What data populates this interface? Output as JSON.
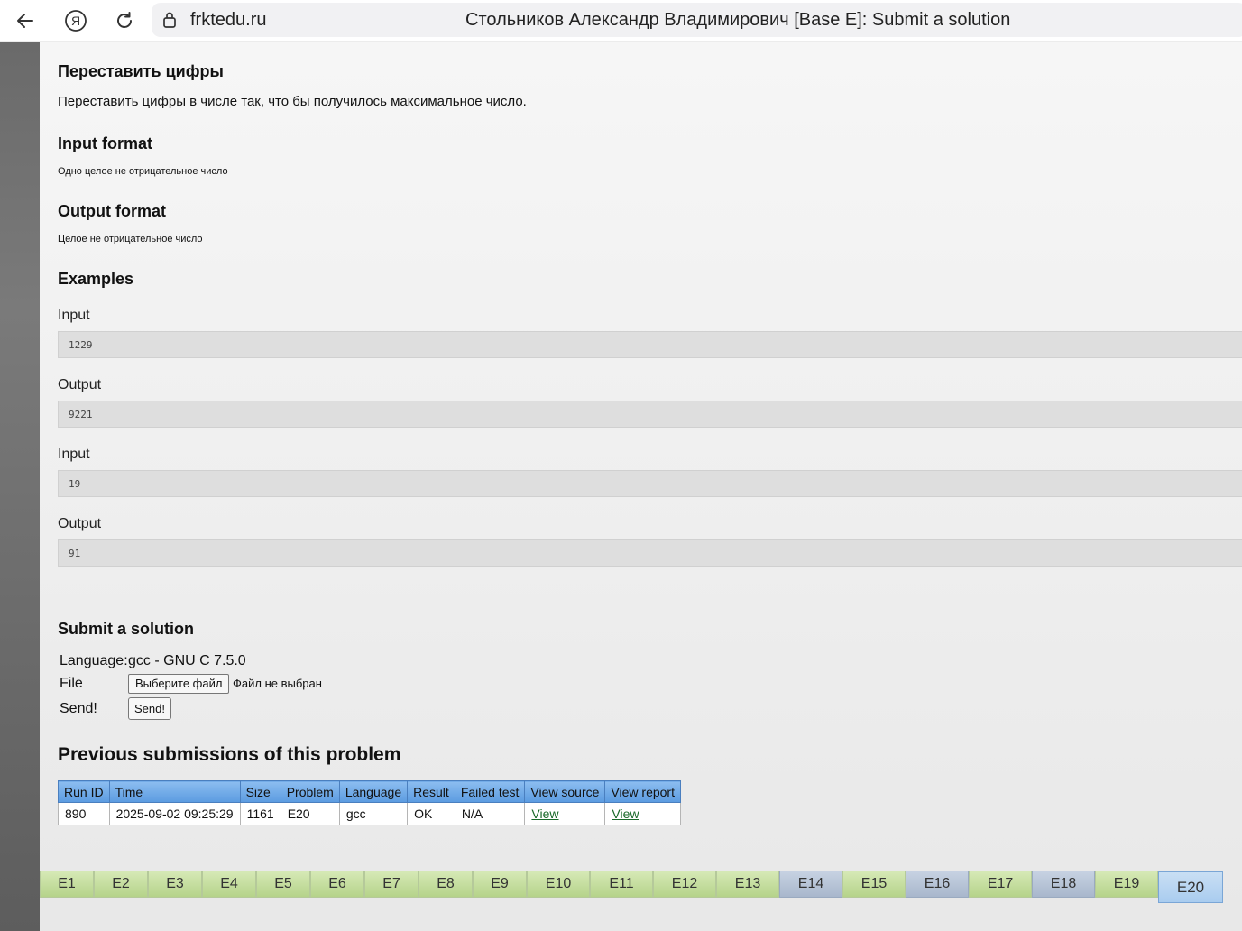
{
  "browser": {
    "url": "frktedu.ru",
    "title": "Стольников Александр Владимирович [Base E]: Submit a solution"
  },
  "problem": {
    "title": "Переставить цифры",
    "statement": "Переставить цифры в числе так, что бы получилось максимальное число.",
    "input_format_heading": "Input format",
    "input_format": "Одно целое не отрицательное число",
    "output_format_heading": "Output format",
    "output_format": "Целое не отрицательное число",
    "examples_heading": "Examples",
    "examples": [
      {
        "label": "Input",
        "value": "1229"
      },
      {
        "label": "Output",
        "value": "9221"
      },
      {
        "label": "Input",
        "value": "19"
      },
      {
        "label": "Output",
        "value": "91"
      }
    ]
  },
  "submit": {
    "heading": "Submit a solution",
    "language_label": "Language:",
    "language_value": "gcc - GNU C 7.5.0",
    "file_label": "File",
    "file_button": "Выберите файл",
    "file_status": "Файл не выбран",
    "send_label": "Send!",
    "send_button": "Send!"
  },
  "previous": {
    "heading": "Previous submissions of this problem",
    "columns": [
      "Run ID",
      "Time",
      "Size",
      "Problem",
      "Language",
      "Result",
      "Failed test",
      "View source",
      "View report"
    ],
    "rows": [
      {
        "run_id": "890",
        "time": "2025-09-02 09:25:29",
        "size": "1161",
        "problem": "E20",
        "language": "gcc",
        "result": "OK",
        "failed_test": "N/A",
        "view_source": "View",
        "view_report": "View"
      }
    ]
  },
  "tabs": [
    {
      "label": "E1",
      "state": "green"
    },
    {
      "label": "E2",
      "state": "green"
    },
    {
      "label": "E3",
      "state": "green"
    },
    {
      "label": "E4",
      "state": "green"
    },
    {
      "label": "E5",
      "state": "green"
    },
    {
      "label": "E6",
      "state": "green"
    },
    {
      "label": "E7",
      "state": "green"
    },
    {
      "label": "E8",
      "state": "green"
    },
    {
      "label": "E9",
      "state": "green"
    },
    {
      "label": "E10",
      "state": "green"
    },
    {
      "label": "E11",
      "state": "green"
    },
    {
      "label": "E12",
      "state": "green"
    },
    {
      "label": "E13",
      "state": "green"
    },
    {
      "label": "E14",
      "state": "blue"
    },
    {
      "label": "E15",
      "state": "green"
    },
    {
      "label": "E16",
      "state": "blue"
    },
    {
      "label": "E17",
      "state": "green"
    },
    {
      "label": "E18",
      "state": "blue"
    },
    {
      "label": "E19",
      "state": "green"
    },
    {
      "label": "E20",
      "state": "active"
    }
  ],
  "colors": {
    "table_header": "#5b9be0",
    "tab_green": "#b5d38a",
    "tab_blue": "#a8b7cc",
    "tab_active": "#a9ccef",
    "link": "#1a6a2a"
  }
}
